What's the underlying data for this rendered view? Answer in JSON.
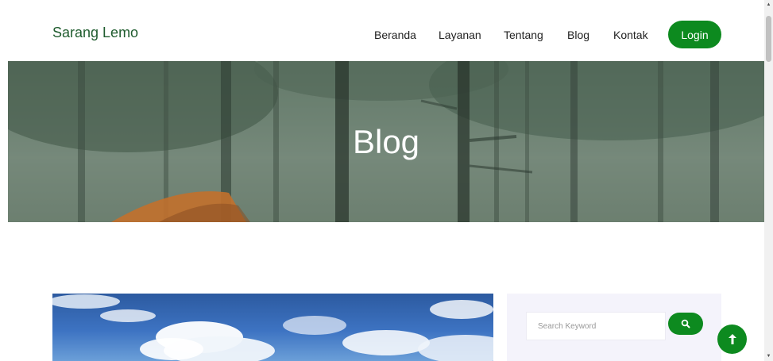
{
  "brand": {
    "name": "Sarang Lemo"
  },
  "nav": {
    "items": [
      "Beranda",
      "Layanan",
      "Tentang",
      "Blog",
      "Kontak"
    ],
    "login_label": "Login"
  },
  "hero": {
    "title": "Blog"
  },
  "sidebar": {
    "search_placeholder": "Search Keyword"
  },
  "colors": {
    "accent": "#0d8a1f",
    "brand_text": "#1f5c2e",
    "sidebar_bg": "#f4f3fb"
  },
  "icons": {
    "search": "search-icon",
    "back_to_top": "arrow-up-icon"
  }
}
